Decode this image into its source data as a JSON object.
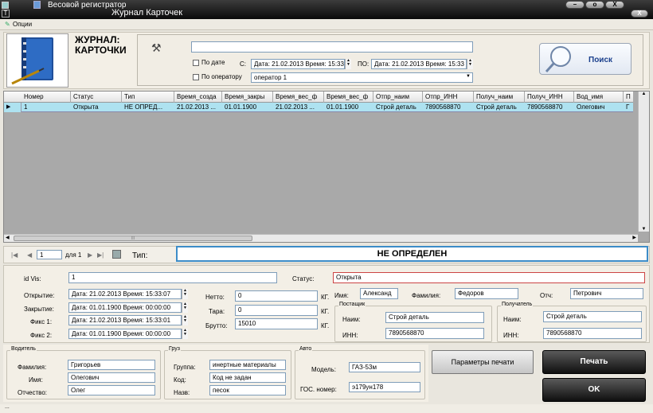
{
  "window": {
    "app_title": "Весовой регистратор",
    "title": "Журнал Карточек",
    "min": "–",
    "max": "o",
    "close": "X",
    "close2": "X"
  },
  "options": {
    "label": "Опции"
  },
  "header": {
    "title": "ЖУРНАЛ: КАРТОЧКИ"
  },
  "filter": {
    "text_value": "",
    "by_date_label": "По дате",
    "from_label": "С:",
    "from_value": "Дата: 21.02.2013 Время: 15:33",
    "to_label": "ПО:",
    "to_value": "Дата: 21.02.2013 Время: 15:33",
    "by_operator_label": "По оператору",
    "operator_value": "оператор 1",
    "search_label": "Поиск"
  },
  "grid": {
    "columns": [
      "Номер",
      "Статус",
      "Тип",
      "Время_созда",
      "Время_закры",
      "Время_вес_ф",
      "Время_вес_ф",
      "Отпр_наим",
      "Отпр_ИНН",
      "Получ_наим",
      "Получ_ИНН",
      "Вод_имя",
      "П"
    ],
    "rows": [
      [
        "1",
        "Открыта",
        "НЕ ОПРЕД...",
        "21.02.2013 ...",
        "01.01.1900",
        "21.02.2013 ...",
        "01.01.1900",
        "Строй деталь",
        "7890568870",
        "Строй деталь",
        "7890568870",
        "Олегович",
        "Г"
      ]
    ],
    "hscroll_thumb": "III"
  },
  "nav": {
    "first": "|◀",
    "prev": "◀",
    "position": "1",
    "of": "для 1",
    "next": "▶",
    "last": "▶|",
    "type_label": "Тип:",
    "type_value": "НЕ ОПРЕДЕЛЕН"
  },
  "details": {
    "id_label": "id Vis:",
    "id_value": "1",
    "status_label": "Статус:",
    "status_value": "Открыта",
    "open_label": "Открытие:",
    "open_value": "Дата: 21.02.2013 Время: 15:33:07",
    "close_label": "Закрытие:",
    "close_value": "Дата: 01.01.1900 Время: 00:00:00",
    "fix1_label": "Фикс 1:",
    "fix1_value": "Дата: 21.02.2013 Время: 15:33:01",
    "fix2_label": "Фикс 2:",
    "fix2_value": "Дата: 01.01.1900 Время: 00:00:00",
    "net_label": "Нетто:",
    "net_value": "0",
    "tare_label": "Тара:",
    "tare_value": "0",
    "gross_label": "Брутто:",
    "gross_value": "15010",
    "unit": "КГ.",
    "name_label": "Имя:",
    "name_value": "Александ",
    "surname_label": "Фамилия:",
    "surname_value": "Федоров",
    "patr_label": "Отч:",
    "patr_value": "Петрович",
    "sender_title": "Постащик",
    "sender_name_label": "Наим:",
    "sender_name_value": "Строй деталь",
    "sender_inn_label": "ИНН:",
    "sender_inn_value": "7890568870",
    "receiver_title": "Получатель",
    "receiver_name_label": "Наим:",
    "receiver_name_value": "Строй деталь",
    "receiver_inn_label": "ИНН:",
    "receiver_inn_value": "7890568870"
  },
  "driver": {
    "title": "Водитель",
    "surname_label": "Фамилия:",
    "surname_value": "Григорьев",
    "name_label": "Имя:",
    "name_value": "Олегович",
    "patr_label": "Отчество:",
    "patr_value": "Олег"
  },
  "cargo": {
    "title": "Груз",
    "group_label": "Группа:",
    "group_value": "инертные материалы",
    "code_label": "Код:",
    "code_value": "Код не задан",
    "name_label": "Назв:",
    "name_value": "песок"
  },
  "auto": {
    "title": "Авто",
    "model_label": "Модель:",
    "model_value": "ГАЗ-53м",
    "plate_label": "ГОС. номер:",
    "plate_value": "э179ун178"
  },
  "buttons": {
    "print_params": "Параметры печати",
    "print": "Печать",
    "ok": "OK"
  },
  "status": {
    "text": "..."
  }
}
